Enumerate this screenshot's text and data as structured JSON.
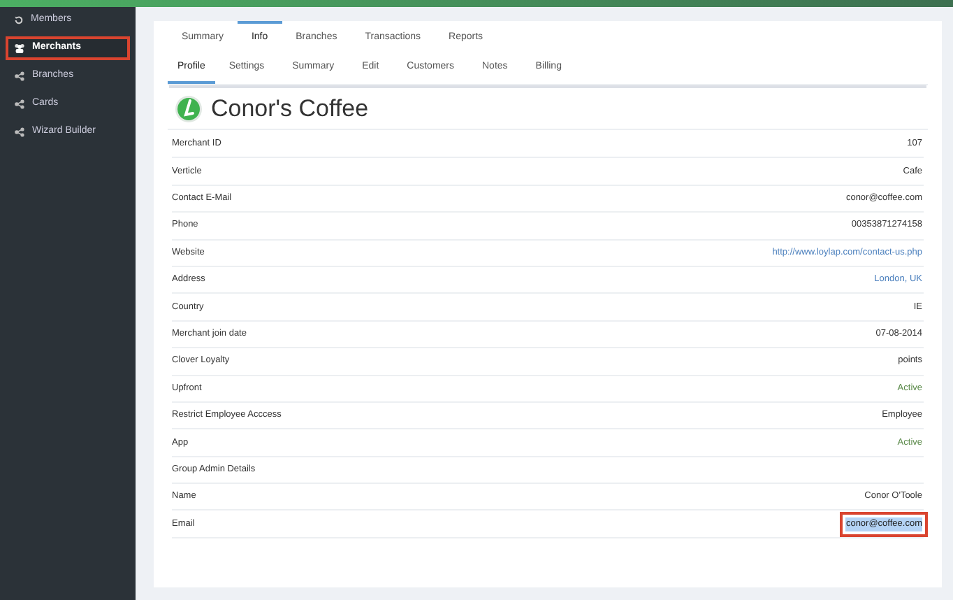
{
  "sidebar": {
    "items": [
      {
        "label": "Members",
        "kind": "history",
        "selected": false
      },
      {
        "label": "Merchants",
        "kind": "group",
        "selected": true
      },
      {
        "label": "Branches",
        "kind": "network",
        "selected": false
      },
      {
        "label": "Cards",
        "kind": "network",
        "selected": false
      },
      {
        "label": "Wizard Builder",
        "kind": "network",
        "selected": false
      }
    ]
  },
  "tabs": [
    {
      "label": "Summary",
      "selected": false
    },
    {
      "label": "Info",
      "selected": true
    },
    {
      "label": "Branches",
      "selected": false
    },
    {
      "label": "Transactions",
      "selected": false
    },
    {
      "label": "Reports",
      "selected": false
    }
  ],
  "subtabs": [
    {
      "label": "Profile",
      "selected": true
    },
    {
      "label": "Settings",
      "selected": false
    },
    {
      "label": "Summary",
      "selected": false
    },
    {
      "label": "Edit",
      "selected": false
    },
    {
      "label": "Customers",
      "selected": false
    },
    {
      "label": "Notes",
      "selected": false
    },
    {
      "label": "Billing",
      "selected": false
    }
  ],
  "merchant": {
    "name": "Conor's Coffee"
  },
  "rows": [
    {
      "label": "Merchant ID",
      "value": "107",
      "kind": "text"
    },
    {
      "label": "Verticle",
      "value": "Cafe",
      "kind": "text"
    },
    {
      "label": "Contact E-Mail",
      "value": "conor@coffee.com",
      "kind": "text"
    },
    {
      "label": "Phone",
      "value": "00353871274158",
      "kind": "text"
    },
    {
      "label": "Website",
      "value": "http://www.loylap.com/contact-us.php",
      "kind": "link"
    },
    {
      "label": "Address",
      "value": "London, UK",
      "kind": "link"
    },
    {
      "label": "Country",
      "value": "IE",
      "kind": "text"
    },
    {
      "label": "Merchant join date",
      "value": "07-08-2014",
      "kind": "text"
    },
    {
      "label": "Clover Loyalty",
      "value": "points",
      "kind": "text"
    },
    {
      "label": "Upfront",
      "value": "Active",
      "kind": "status"
    },
    {
      "label": "Restrict Employee Acccess",
      "value": "Employee",
      "kind": "text"
    },
    {
      "label": "App",
      "value": "Active",
      "kind": "status"
    },
    {
      "label": "Group Admin Details",
      "kind": "heading"
    },
    {
      "label": "Name",
      "value": "Conor O'Toole",
      "kind": "text"
    },
    {
      "label": "Email",
      "value": "conor@coffee.com",
      "kind": "highlighted"
    }
  ]
}
